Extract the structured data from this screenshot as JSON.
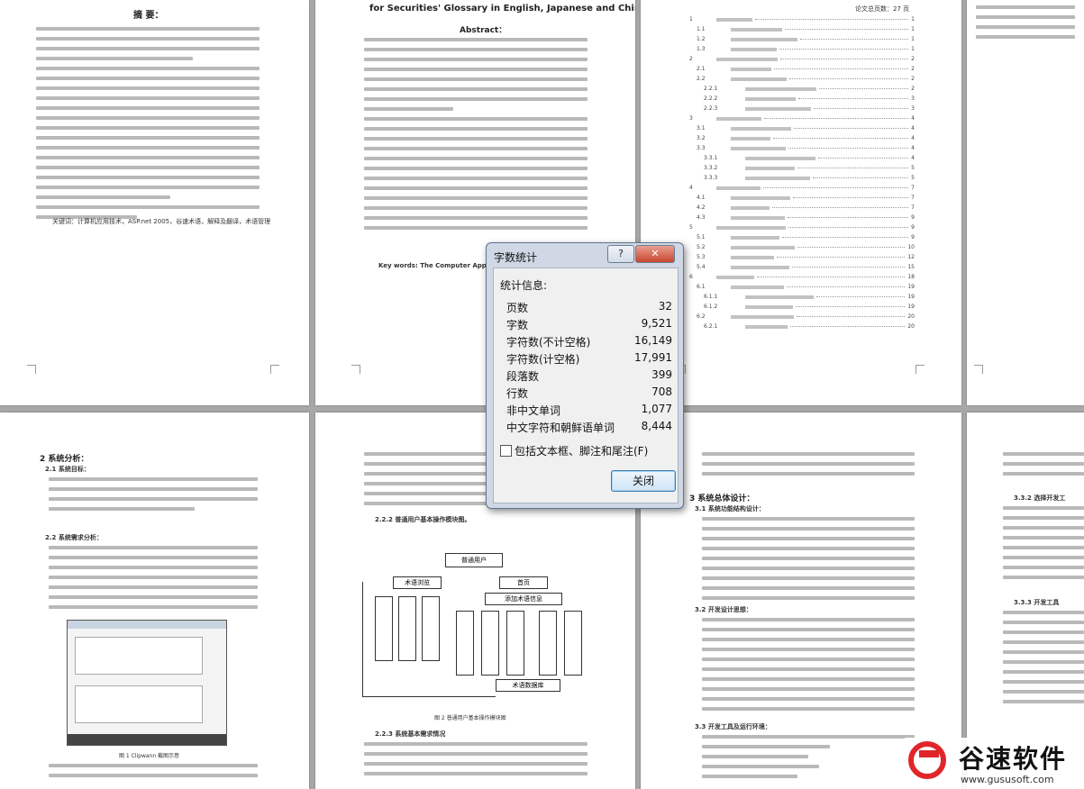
{
  "dialog": {
    "title": "字数统计",
    "help_label": "?",
    "close_x": "✕",
    "section": "统计信息:",
    "stats": [
      {
        "label": "页数",
        "value": "32"
      },
      {
        "label": "字数",
        "value": "9,521"
      },
      {
        "label": "字符数(不计空格)",
        "value": "16,149"
      },
      {
        "label": "字符数(计空格)",
        "value": "17,991"
      },
      {
        "label": "段落数",
        "value": "399"
      },
      {
        "label": "行数",
        "value": "708"
      },
      {
        "label": "非中文单词",
        "value": "1,077"
      },
      {
        "label": "中文字符和朝鲜语单词",
        "value": "8,444"
      }
    ],
    "checkbox_label": "包括文本框、脚注和尾注(F)",
    "close_label": "关闭"
  },
  "pages": {
    "p1_title": "摘  要：",
    "p1_keywords": "关键词：计算机应用技术，ASP.net 2005，谷速术语，解释及翻译，术语管理",
    "p2_title": "for Securities' Glossary in English, Japanese and Chinese",
    "p2_abstract": "Abstract：",
    "p2_keywords": "Key words: The Computer Application",
    "p3_header": "论文总页数：27 页",
    "p5_heading": "2    系统分析：",
    "p5_sub": "2.1  系统目标：",
    "p5_sub2": "2.2  系统需求分析：",
    "p5_figcap": "图 1 Clipwann 截图示意",
    "p6_sub": "2.2.2    普通用户基本操作模块图。",
    "p6_figcap": "图 2 普通用户基本操作模块图",
    "p6_sub2": "2.2.3    系统基本需求情况",
    "p7_heading": "3    系统总体设计：",
    "p7_sub": "3.1  系统功能结构设计：",
    "p7_sub2": "3.2  开发设计思想：",
    "p7_sub3": "3.3  开发工具及运行环境：",
    "p8_sub": "3.3.2    选择开发工",
    "p8_sub2": "3.3.3    开发工具"
  },
  "toc": [
    {
      "num": "1",
      "page": "1"
    },
    {
      "num": "1.1",
      "page": "1"
    },
    {
      "num": "1.2",
      "page": "1"
    },
    {
      "num": "1.3",
      "page": "1"
    },
    {
      "num": "2",
      "page": "2"
    },
    {
      "num": "2.1",
      "page": "2"
    },
    {
      "num": "2.2",
      "page": "2"
    },
    {
      "num": "2.2.1",
      "page": "2"
    },
    {
      "num": "2.2.2",
      "page": "3"
    },
    {
      "num": "2.2.3",
      "page": "3"
    },
    {
      "num": "3",
      "page": "4"
    },
    {
      "num": "3.1",
      "page": "4"
    },
    {
      "num": "3.2",
      "page": "4"
    },
    {
      "num": "3.3",
      "page": "4"
    },
    {
      "num": "3.3.1",
      "page": "4"
    },
    {
      "num": "3.3.2",
      "page": "5"
    },
    {
      "num": "3.3.3",
      "page": "5"
    },
    {
      "num": "4",
      "page": "7"
    },
    {
      "num": "4.1",
      "page": "7"
    },
    {
      "num": "4.2",
      "page": "7"
    },
    {
      "num": "4.3",
      "page": "9"
    },
    {
      "num": "5",
      "page": "9"
    },
    {
      "num": "5.1",
      "page": "9"
    },
    {
      "num": "5.2",
      "page": "10"
    },
    {
      "num": "5.3",
      "page": "12"
    },
    {
      "num": "5.4",
      "page": "15"
    },
    {
      "num": "6",
      "page": "18"
    },
    {
      "num": "6.1",
      "page": "19"
    },
    {
      "num": "6.1.1",
      "page": "19"
    },
    {
      "num": "6.1.2",
      "page": "19"
    },
    {
      "num": "6.2",
      "page": "20"
    },
    {
      "num": "6.2.1",
      "page": "20"
    }
  ],
  "figure": {
    "root": "普通用户",
    "left": "术语浏览",
    "right": "首页",
    "mid": "添加术语信息",
    "bottom": "术语数据库"
  },
  "watermark": {
    "name": "谷速软件",
    "url": "www.gususoft.com"
  },
  "colors": {
    "workspace": "#a8a8a8",
    "dialog_frame": "#cfd8e4",
    "close_red": "#c9462d",
    "brand_red": "#e0262b"
  }
}
